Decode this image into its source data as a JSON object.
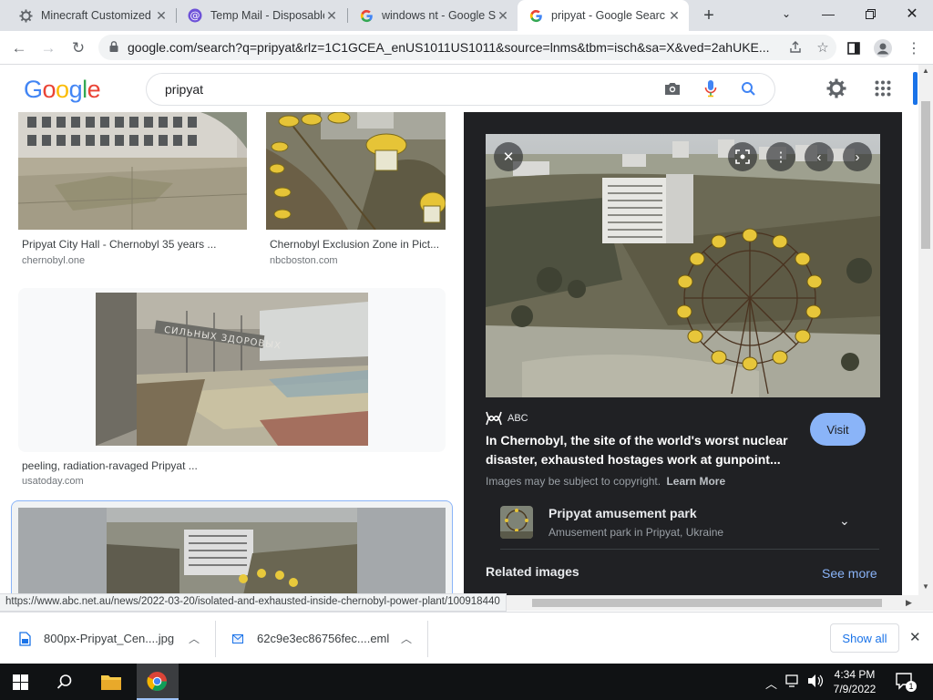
{
  "tabs": [
    {
      "title": "Minecraft Customized",
      "icon": "gear-icon",
      "active": false
    },
    {
      "title": "Temp Mail - Disposable",
      "icon": "at-icon",
      "active": false
    },
    {
      "title": "windows nt - Google S",
      "icon": "google-icon",
      "active": false
    },
    {
      "title": "pripyat - Google Searc",
      "icon": "google-icon",
      "active": true
    }
  ],
  "address_bar": {
    "url": "google.com/search?q=pripyat&rlz=1C1GCEA_enUS1011US1011&source=lnms&tbm=isch&sa=X&ved=2ahUKE..."
  },
  "google": {
    "logo_letters": [
      "G",
      "o",
      "o",
      "g",
      "l",
      "e"
    ],
    "logo_colors": [
      "#4285f4",
      "#ea4335",
      "#fbbc05",
      "#4285f4",
      "#34a853",
      "#ea4335"
    ],
    "search_value": "pripyat"
  },
  "results": [
    {
      "title": "Pripyat City Hall - Chernobyl 35 years ...",
      "source": "chernobyl.one"
    },
    {
      "title": "Chernobyl Exclusion Zone in Pict...",
      "source": "nbcboston.com"
    },
    {
      "title": "peeling, radiation-ravaged Pripyat ...",
      "source": "usatoday.com"
    }
  ],
  "preview": {
    "source_name": "ABC",
    "headline": "In Chernobyl, the site of the world's worst nuclear disaster, exhausted hostages work at gunpoint...",
    "visit_label": "Visit",
    "copyright_text": "Images may be subject to copyright.",
    "learn_more": "Learn More",
    "entity_title": "Pripyat amusement park",
    "entity_subtitle": "Amusement park in Pripyat, Ukraine",
    "related_label": "Related images",
    "see_more": "See more"
  },
  "status_url": "https://www.abc.net.au/news/2022-03-20/isolated-and-exhausted-inside-chernobyl-power-plant/100918440",
  "downloads": [
    {
      "name": "800px-Pripyat_Cen....jpg"
    },
    {
      "name": "62c9e3ec86756fec....eml"
    }
  ],
  "downloads_show_all": "Show all",
  "taskbar": {
    "time": "4:34 PM",
    "date": "7/9/2022",
    "notification_count": "1"
  },
  "colors": {
    "accent_blue": "#1a73e8",
    "panel_bg": "#202124",
    "visit_button": "#8ab4f8",
    "taskbar_bg": "#101214"
  }
}
